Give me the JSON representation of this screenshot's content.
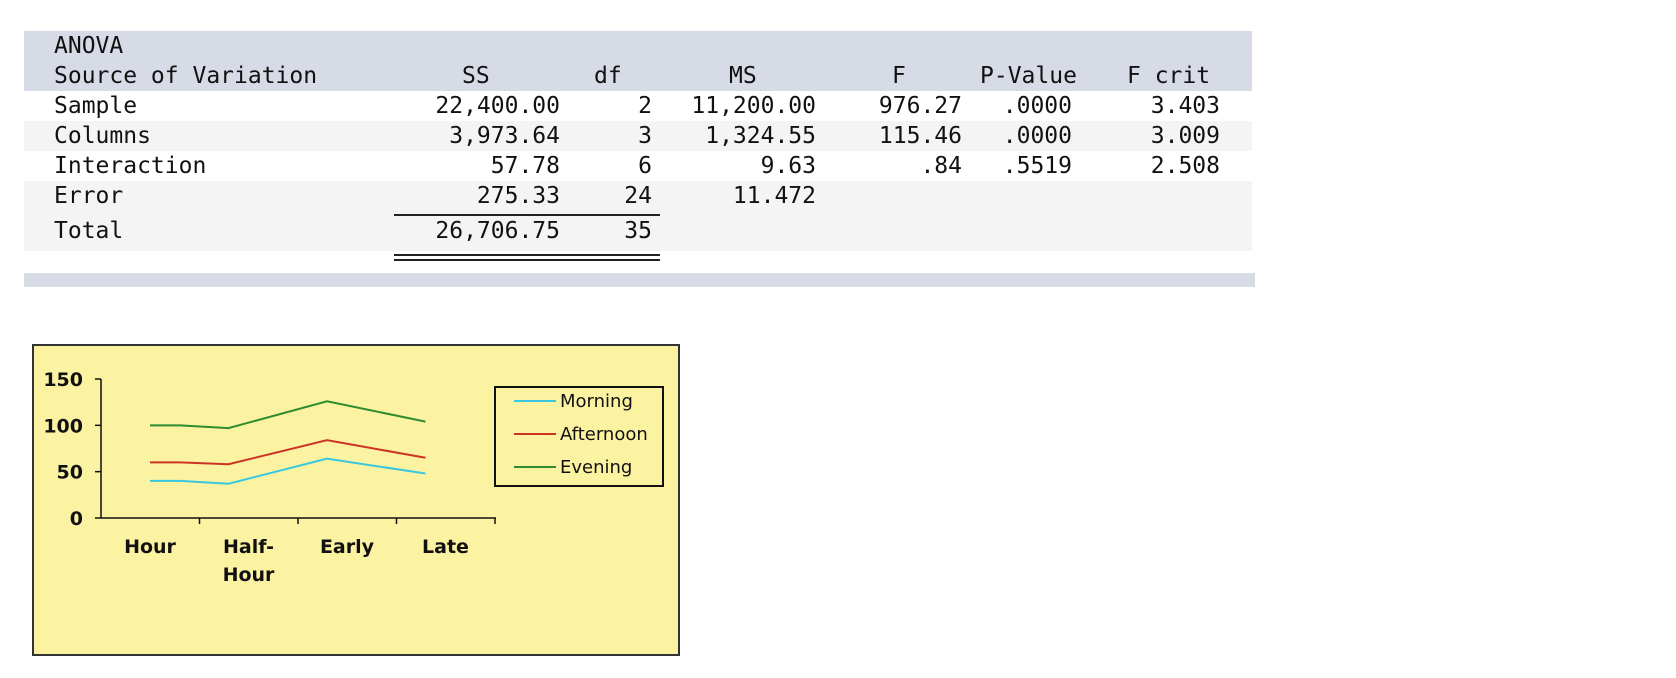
{
  "anova": {
    "title": "ANOVA",
    "headers": {
      "source": "Source of Variation",
      "ss": "SS",
      "df": "df",
      "ms": "MS",
      "f": "F",
      "p": "P-Value",
      "fcrit": "F crit"
    },
    "rows": [
      {
        "source": "Sample",
        "ss": "22,400.00",
        "df": "2",
        "ms": "11,200.00",
        "f": "976.27",
        "p": ".0000",
        "fcrit": "3.403"
      },
      {
        "source": "Columns",
        "ss": "3,973.64",
        "df": "3",
        "ms": "1,324.55",
        "f": "115.46",
        "p": ".0000",
        "fcrit": "3.009"
      },
      {
        "source": "Interaction",
        "ss": "57.78",
        "df": "6",
        "ms": "9.63",
        "f": ".84",
        "p": ".5519",
        "fcrit": "2.508"
      },
      {
        "source": "Error",
        "ss": "275.33",
        "df": "24",
        "ms": "11.472",
        "f": "",
        "p": "",
        "fcrit": ""
      }
    ],
    "total": {
      "source": "Total",
      "ss": "26,706.75",
      "df": "35"
    }
  },
  "chart_data": {
    "type": "line",
    "categories": [
      "Hour",
      "Half-Hour",
      "Early",
      "Late"
    ],
    "category_lines": [
      [
        "Hour"
      ],
      [
        "Half-",
        "Hour"
      ],
      [
        "Early"
      ],
      [
        "Late"
      ]
    ],
    "series": [
      {
        "name": "Morning",
        "values": [
          40,
          37,
          64,
          48
        ],
        "color": "#39c6e0"
      },
      {
        "name": "Afternoon",
        "values": [
          60,
          58,
          84,
          65
        ],
        "color": "#cc3324"
      },
      {
        "name": "Evening",
        "values": [
          100,
          97,
          126,
          104
        ],
        "color": "#2e8b2e"
      }
    ],
    "ylim": [
      0,
      150
    ],
    "yticks": [
      0,
      50,
      100,
      150
    ],
    "grid": false,
    "legend_position": "right",
    "background": "#fbf3a2"
  }
}
